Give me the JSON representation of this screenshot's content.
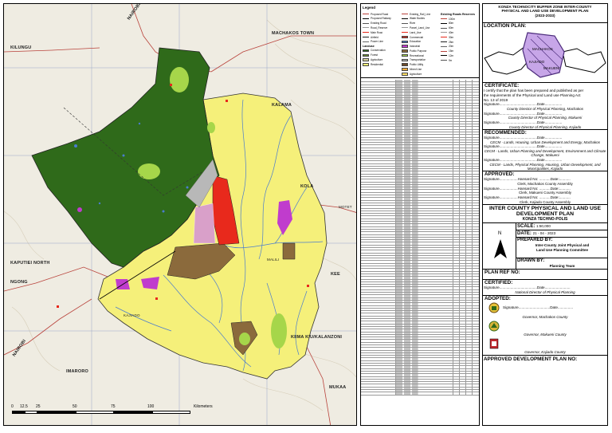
{
  "map": {
    "places": {
      "nairobi_top": "NAIROBI",
      "machakos_town": "MACHAKOS TOWN",
      "kilungu": "KILUNGU",
      "kapiti_north": "KAPUTIEI NORTH",
      "ngong": "NGONG",
      "nairobi_left": "NAIROBI",
      "imaroro": "IMARORO",
      "mukaa": "MUKAA",
      "kee": "KEE",
      "kola": "KOLA",
      "kalama": "KALAMA",
      "kiima_kiu": "KIIMA KIU/KALANZONI",
      "malili": "MALILI",
      "motet": "MOTET",
      "kajiado": "KAJIADO"
    },
    "scale_ticks": [
      "0",
      "12.5",
      "25",
      "50",
      "75",
      "100"
    ],
    "scale_units": "Kilometers",
    "colors": {
      "forest": "#2f6a1a",
      "yellow_zone": "#f5f07a",
      "brown": "#8b6a3c",
      "red": "#e8291c",
      "magenta": "#c03ccd",
      "light_green": "#a6d64a",
      "grey": "#b8b8b8",
      "river": "#4a7ccf"
    }
  },
  "legend": {
    "title": "Legend",
    "col1": [
      "Proposed Road",
      "Proposed Railway",
      "Existing Road",
      "Road_Reserve",
      "Main Road",
      "Airfield",
      "Power Line"
    ],
    "col1_head": "Landuse",
    "col1b": [
      "Conservation",
      "Forest",
      "Agriculture",
      "Residential"
    ],
    "col2": [
      "Existing_Rail_Line",
      "Water Bodies",
      "River",
      "Parcel_Land_Use",
      "Land_Use"
    ],
    "col2b": [
      "Commercial",
      "Education",
      "Industrial",
      "Public Purpose",
      "Recreational",
      "Transportation",
      "Public Utility",
      "Mixed Use",
      "Agriculture"
    ],
    "col3_head": "Existing Roads Reserves",
    "col3": [
      "100m",
      "80m",
      "60m",
      "40m",
      "30m",
      "25m",
      "20m",
      "15m",
      "12m",
      "9m"
    ]
  },
  "panel": {
    "title_lines": [
      "KONZA TECHNOCITY BUFFER ZONE INTER-COUNTY",
      "PHYSICAL AND LAND USE DEVELOPMENT PLAN",
      "(2023-2033)"
    ],
    "location_head": "LOCATION PLAN:",
    "location_labels": {
      "machakos": "MACHAKOS",
      "kajiado": "KAJIADO",
      "makueni": "MAKUENI"
    },
    "certificate_head": "CERTIFICATE:",
    "certificate_text1": "I certify that the plan has been prepared and published as per",
    "certificate_text2": "the requirements of the Physical and Land use Planning Act",
    "certificate_text3": "No. 13 of 2019",
    "sig_line": "Signature.....................................Date.................",
    "cert_roles": [
      "County Director of Physical Planning, Machakos",
      "County Director of Physical Planning, Makueni",
      "County Director of Physical Planning, Kajiado"
    ],
    "recommended_head": "RECOMMENDED:",
    "rec_roles": [
      "CECM - Lands, Housing, Urban Development and Energy, Machakos",
      "CECM - Lands, Urban Planning and Development, Environment and Climate Change, Makueni",
      "CECM - Lands, Physical Planning, Housing, Urban Development, and Municipalities, Kajiado"
    ],
    "approved_head": "APPROVED:",
    "hansard_line": "Signature..................Hansard No: ...........Date:...........",
    "app_roles": [
      "Clerk, Machakos County Assembly",
      "Clerk, Makueni County Assembly",
      "Clerk, Kajiado County Assembly"
    ],
    "plan_title1": "INTER COUNTY PHYSICAL AND LAND USE",
    "plan_title2": "DEVELOPMENT PLAN",
    "plan_title3": "KONZA TECHNO-POLIS",
    "north_letter": "N",
    "scale_label": "SCALE:",
    "scale_value": "1:50,000",
    "date_label": "DATE:",
    "date_value": "21 - 04 - 2023",
    "prepared_label": "PREPARED BY:",
    "prepared_value1": "Inter-County Joint Physical and",
    "prepared_value2": "Land Use Planning Committee",
    "drawn_label": "DRAWN BY:",
    "drawn_value": "Planning Team",
    "planref_label": "PLAN REF NO:",
    "certified_head": "CERTIFIED:",
    "certified_sig": "Signature.....................................Date.........................",
    "certified_role": "National Director of Physical Planning",
    "adopted_head": "ADOPTED:",
    "adopted_sig": "Signature...............................Date...............",
    "adopted_roles": [
      "Governor, Machakos County",
      "Governor, Makueni County",
      "Governor, Kajiado County"
    ],
    "approved_dev_label": "APPROVED DEVELOPMENT PLAN NO:"
  }
}
